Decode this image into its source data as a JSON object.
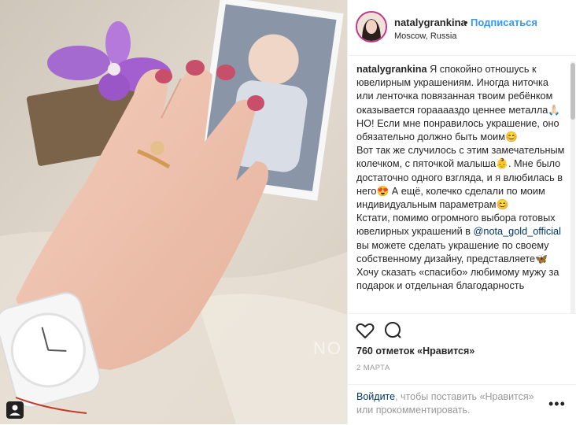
{
  "header": {
    "username": "natalygrankina",
    "separator": "•",
    "follow_label": "Подписаться",
    "location": "Moscow, Russia"
  },
  "photo": {
    "watermark": "NO"
  },
  "caption": {
    "author": "natalygrankina",
    "p1": "Я спокойно отношусь к ювелирным украшениям. Иногда ниточка или ленточка повязанная твоим ребёнком оказывается горааааздо ценнее металла🙏🏻 НО! Если мне понравилось украшение, оно обязательно должно быть моим😊",
    "p2": "Вот так же случилось с этим замечательным колечком, с пяточкой малыша👶. Мне было достаточно одного взгляда, и я влюбилась в него😍 А ещё, колечко сделали по моим индивидуальным параметрам😊",
    "p3a": "Кстати, помимо огромного выбора готовых ювелирных украшений в ",
    "mention": "@nota_gold_official",
    "p3b": " вы можете сделать украшение по своему собственному дизайну, представляете🦋",
    "p4": "Хочу сказать «спасибо» любимому мужу за подарок и отдельная благодарность"
  },
  "actions": {
    "likes": "760 отметок «Нравится»",
    "date": "2 МАРТА",
    "like_icon": "heart-icon",
    "comment_icon": "comment-icon"
  },
  "footer": {
    "login_link": "Войдите",
    "login_text_a": ", чтобы поставить «Нравится»",
    "login_text_b": "или прокомментировать.",
    "more": "•••"
  },
  "colors": {
    "link": "#3897f0",
    "mention": "#003569",
    "muted": "#999999",
    "text": "#262626"
  }
}
